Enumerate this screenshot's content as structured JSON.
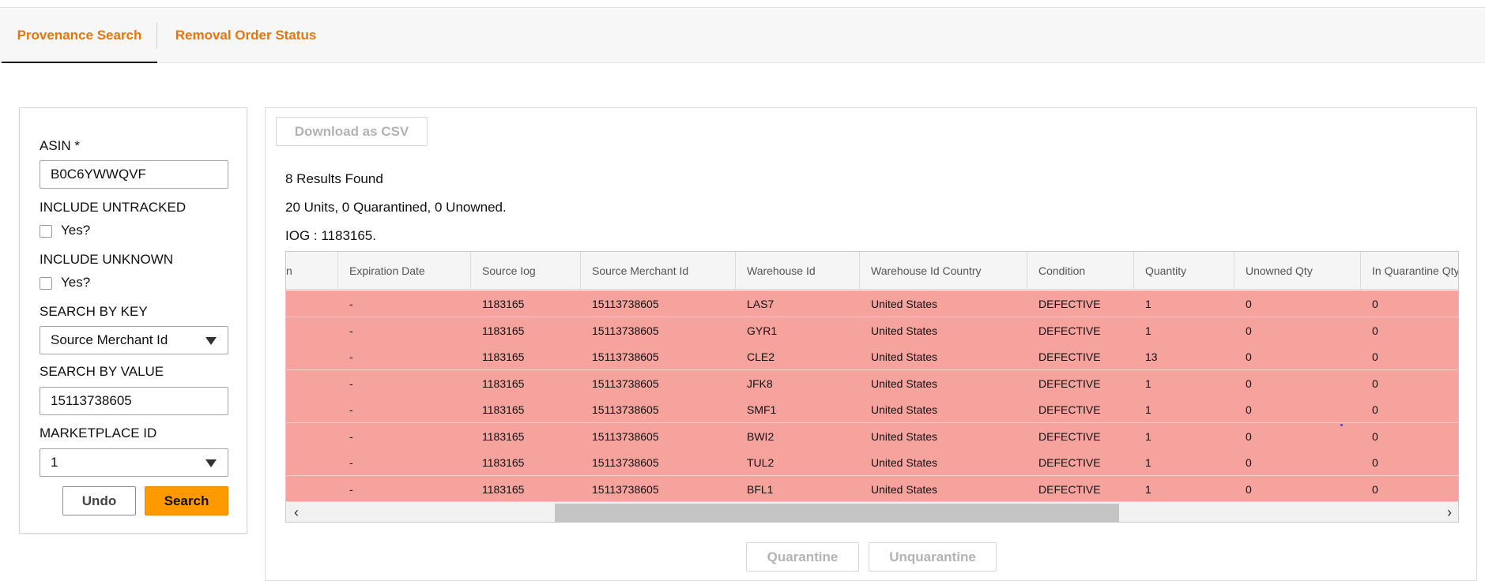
{
  "tabs": {
    "provenance": "Provenance Search",
    "removal": "Removal Order Status"
  },
  "search": {
    "asin_label": "ASIN *",
    "asin_value": "B0C6YWWQVF",
    "untracked_label": "INCLUDE UNTRACKED",
    "untracked_check": "Yes?",
    "unknown_label": "INCLUDE UNKNOWN",
    "unknown_check": "Yes?",
    "key_label": "SEARCH BY KEY",
    "key_value": "Source Merchant Id",
    "value_label": "SEARCH BY VALUE",
    "value_value": "15113738605",
    "marketplace_label": "MARKETPLACE ID",
    "marketplace_value": "1",
    "undo": "Undo",
    "search": "Search"
  },
  "results": {
    "download": "Download as CSV",
    "count": "8 Results Found",
    "units": "20 Units, 0 Quarantined, 0 Unowned.",
    "iog": "IOG : 1183165.",
    "quarantine": "Quarantine",
    "unquarantine": "Unquarantine",
    "row_color": "#f6a39e"
  },
  "table": {
    "headers": [
      "n",
      "Expiration Date",
      "Source Iog",
      "Source Merchant Id",
      "Warehouse Id",
      "Warehouse Id Country",
      "Condition",
      "Quantity",
      "Unowned Qty",
      "In Quarantine Qty"
    ],
    "rows": [
      [
        "",
        "-",
        "1183165",
        "15113738605",
        "LAS7",
        "United States",
        "DEFECTIVE",
        "1",
        "0",
        "0"
      ],
      [
        "",
        "-",
        "1183165",
        "15113738605",
        "GYR1",
        "United States",
        "DEFECTIVE",
        "1",
        "0",
        "0"
      ],
      [
        "",
        "-",
        "1183165",
        "15113738605",
        "CLE2",
        "United States",
        "DEFECTIVE",
        "13",
        "0",
        "0"
      ],
      [
        "",
        "-",
        "1183165",
        "15113738605",
        "JFK8",
        "United States",
        "DEFECTIVE",
        "1",
        "0",
        "0"
      ],
      [
        "",
        "-",
        "1183165",
        "15113738605",
        "SMF1",
        "United States",
        "DEFECTIVE",
        "1",
        "0",
        "0"
      ],
      [
        "",
        "-",
        "1183165",
        "15113738605",
        "BWI2",
        "United States",
        "DEFECTIVE",
        "1",
        "0",
        "0"
      ],
      [
        "",
        "-",
        "1183165",
        "15113738605",
        "TUL2",
        "United States",
        "DEFECTIVE",
        "1",
        "0",
        "0"
      ],
      [
        "",
        "-",
        "1183165",
        "15113738605",
        "BFL1",
        "United States",
        "DEFECTIVE",
        "1",
        "0",
        "0"
      ]
    ]
  },
  "icons": {
    "dropdown": "chevron-down-icon",
    "scroll_left": "chevron-left-icon",
    "scroll_right": "chevron-right-icon"
  }
}
